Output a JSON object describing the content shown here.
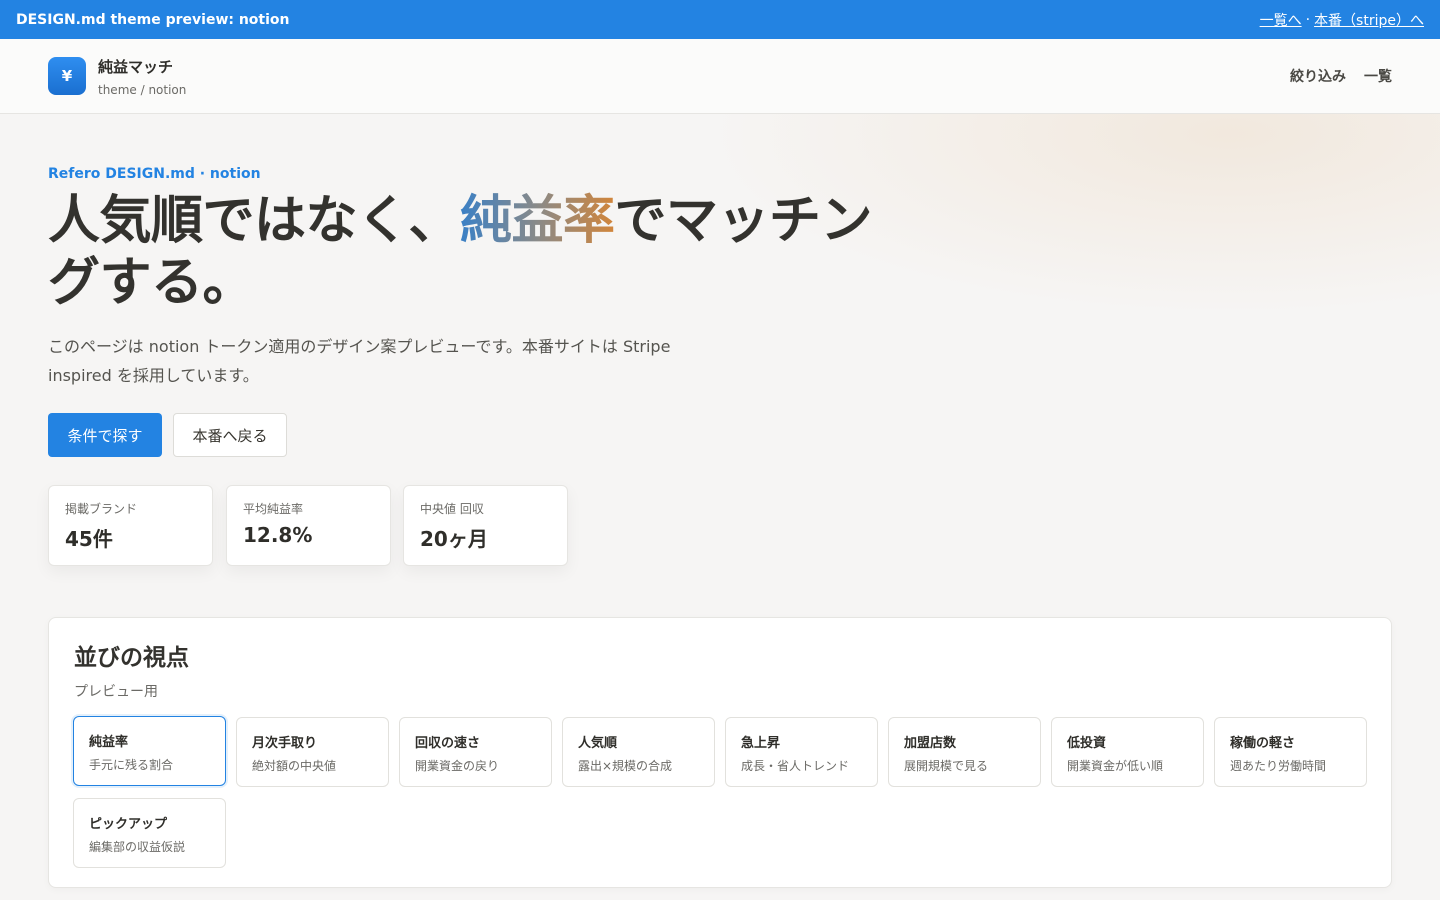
{
  "banner": {
    "title": "DESIGN.md theme preview: notion",
    "link_list": "一覧へ",
    "separator": "·",
    "link_prod": "本番（stripe）へ"
  },
  "nav": {
    "logo_glyph": "¥",
    "brand_name": "純益マッチ",
    "brand_sub": "theme / notion",
    "links": [
      "絞り込み",
      "一覧"
    ]
  },
  "hero": {
    "eyebrow": "Refero DESIGN.md · notion",
    "headline_before": "人気順ではなく、",
    "headline_highlight": "純益率",
    "headline_after": "でマッチングする。",
    "lead": "このページは notion トークン適用のデザイン案プレビューです。本番サイトは Stripe inspired を採用しています。",
    "cta_primary": "条件で探す",
    "cta_secondary": "本番へ戻る"
  },
  "stats": [
    {
      "label": "掲載ブランド",
      "value": "45件"
    },
    {
      "label": "平均純益率",
      "value": "12.8%"
    },
    {
      "label": "中央値 回収",
      "value": "20ヶ月"
    }
  ],
  "sort_panel": {
    "title": "並びの視点",
    "subtitle": "プレビュー用",
    "selected": "純益率",
    "options": [
      {
        "title": "純益率",
        "desc": "手元に残る割合"
      },
      {
        "title": "月次手取り",
        "desc": "絶対額の中央値"
      },
      {
        "title": "回収の速さ",
        "desc": "開業資金の戻り"
      },
      {
        "title": "人気順",
        "desc": "露出×規模の合成"
      },
      {
        "title": "急上昇",
        "desc": "成長・省人トレンド"
      },
      {
        "title": "加盟店数",
        "desc": "展開規模で見る"
      },
      {
        "title": "低投資",
        "desc": "開業資金が低い順"
      },
      {
        "title": "稼働の軽さ",
        "desc": "週あたり労働時間"
      },
      {
        "title": "ピックアップ",
        "desc": "編集部の収益仮説"
      }
    ]
  },
  "colors": {
    "accent": "#2383e2",
    "text": "#37352f",
    "background": "#f6f5f4",
    "highlight_gradient": [
      "#3a80c6",
      "#d2853a"
    ]
  }
}
